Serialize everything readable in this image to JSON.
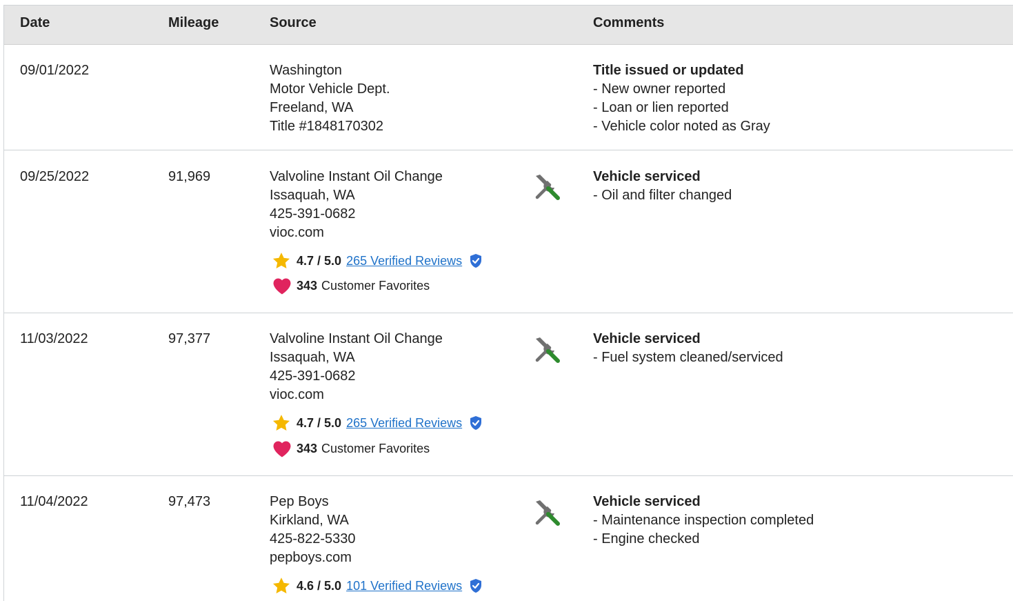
{
  "header": {
    "date": "Date",
    "mileage": "Mileage",
    "source": "Source",
    "comments": "Comments"
  },
  "rows": [
    {
      "date": "09/01/2022",
      "mileage": "",
      "source_lines": [
        "Washington",
        "Motor Vehicle Dept.",
        "Freeland, WA",
        "Title #1848170302"
      ],
      "comment_title": "Title issued or updated",
      "comment_bullets": [
        "- New owner reported",
        "- Loan or lien reported",
        "- Vehicle color noted as Gray"
      ]
    },
    {
      "date": "09/25/2022",
      "mileage": "91,969",
      "source_lines": [
        "Valvoline Instant Oil Change",
        "Issaquah, WA",
        "425-391-0682",
        "vioc.com"
      ],
      "rating": "4.7 / 5.0",
      "reviews": "265 Verified Reviews",
      "favorites_count": "343",
      "favorites_label": "Customer Favorites",
      "service_icon": "wrench-screwdriver-icon",
      "comment_title": "Vehicle serviced",
      "comment_bullets": [
        "- Oil and filter changed"
      ]
    },
    {
      "date": "11/03/2022",
      "mileage": "97,377",
      "source_lines": [
        "Valvoline Instant Oil Change",
        "Issaquah, WA",
        "425-391-0682",
        "vioc.com"
      ],
      "rating": "4.7 / 5.0",
      "reviews": "265 Verified Reviews",
      "favorites_count": "343",
      "favorites_label": "Customer Favorites",
      "service_icon": "wrench-screwdriver-icon",
      "comment_title": "Vehicle serviced",
      "comment_bullets": [
        "- Fuel system cleaned/serviced"
      ]
    },
    {
      "date": "11/04/2022",
      "mileage": "97,473",
      "source_lines": [
        "Pep Boys",
        "Kirkland, WA",
        "425-822-5330",
        "pepboys.com"
      ],
      "rating": "4.6 / 5.0",
      "reviews": "101 Verified Reviews",
      "service_icon": "wrench-screwdriver-icon",
      "comment_title": "Vehicle serviced",
      "comment_bullets": [
        "- Maintenance inspection completed",
        "- Engine checked"
      ]
    }
  ],
  "colors": {
    "header_bg": "#e6e6e6",
    "link": "#1f72c9",
    "star": "#f5b800",
    "heart": "#e0245e",
    "shield": "#2f6fd6",
    "screwdriver": "#2e8b2e",
    "wrench": "#707070"
  }
}
